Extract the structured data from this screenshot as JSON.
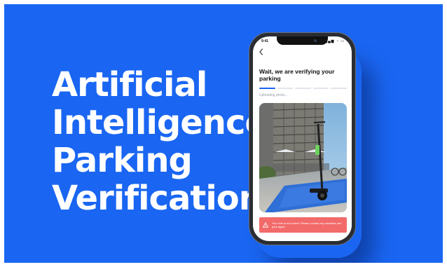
{
  "headline": {
    "lines": [
      "Artificial",
      "Intelligence",
      "Parking",
      "Verification"
    ]
  },
  "phone": {
    "status_time": "9:41",
    "status_icons": "▂▄▆ ◔ ▭",
    "back_icon": "chevron-left-icon",
    "title": "Wait, we are verifying your parking",
    "progress": {
      "segments": 5,
      "completed": 1
    },
    "upload_status": "Uploading photo...",
    "warning": {
      "icon": "warning-triangle-icon",
      "message": "Your ride is not ended. Please contact any mistakes and park again."
    }
  },
  "colors": {
    "background": "#1a66f2",
    "accent": "#1a66f2",
    "warning": "#f26a6a"
  }
}
